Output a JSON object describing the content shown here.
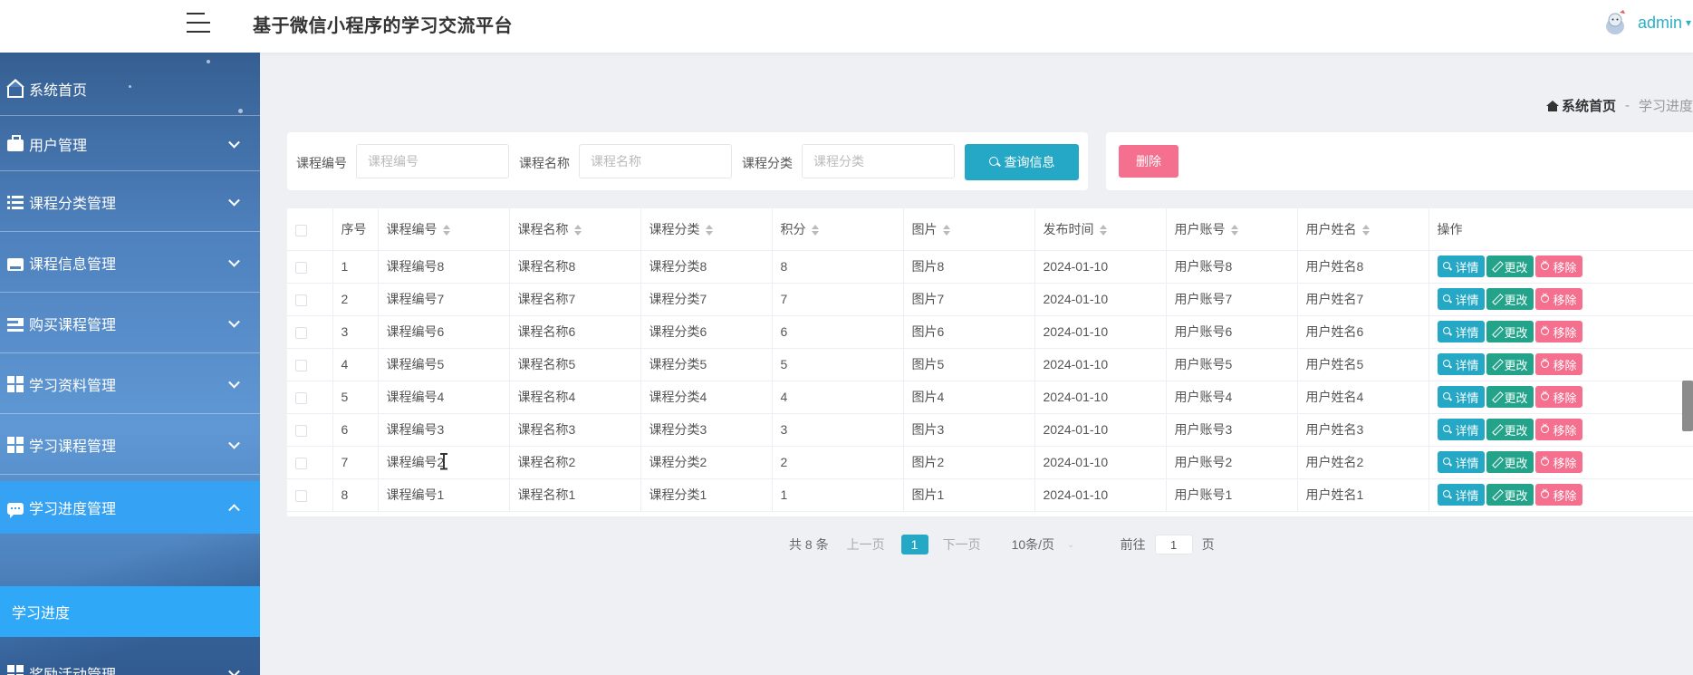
{
  "header": {
    "title": "基于微信小程序的学习交流平台",
    "username": "admin"
  },
  "sidebar": {
    "items": [
      {
        "label": "系统首页",
        "icon": "home-icon"
      },
      {
        "label": "用户管理",
        "icon": "briefcase-icon"
      },
      {
        "label": "课程分类管理",
        "icon": "list-icon"
      },
      {
        "label": "课程信息管理",
        "icon": "tray-icon"
      },
      {
        "label": "购买课程管理",
        "icon": "bars-icon"
      },
      {
        "label": "学习资料管理",
        "icon": "grid-icon"
      },
      {
        "label": "学习课程管理",
        "icon": "grid-icon"
      },
      {
        "label": "学习进度管理",
        "icon": "chat-icon"
      },
      {
        "label": "奖励活动管理",
        "icon": "grid-icon"
      }
    ],
    "active_sub": "学习进度"
  },
  "breadcrumb": {
    "home": "系统首页",
    "separator": "-",
    "current": "学习进度"
  },
  "search": {
    "label1": "课程编号",
    "placeholder1": "课程编号",
    "label2": "课程名称",
    "placeholder2": "课程名称",
    "label3": "课程分类",
    "placeholder3": "课程分类",
    "button": "查询信息"
  },
  "actions": {
    "delete": "删除"
  },
  "table": {
    "columns": [
      "序号",
      "课程编号",
      "课程名称",
      "课程分类",
      "积分",
      "图片",
      "发布时间",
      "用户账号",
      "用户姓名",
      "操作"
    ],
    "detail_label": "详情",
    "edit_label": "更改",
    "remove_label": "移除",
    "rows": [
      [
        "1",
        "课程编号8",
        "课程名称8",
        "课程分类8",
        "8",
        "图片8",
        "2024-01-10",
        "用户账号8",
        "用户姓名8"
      ],
      [
        "2",
        "课程编号7",
        "课程名称7",
        "课程分类7",
        "7",
        "图片7",
        "2024-01-10",
        "用户账号7",
        "用户姓名7"
      ],
      [
        "3",
        "课程编号6",
        "课程名称6",
        "课程分类6",
        "6",
        "图片6",
        "2024-01-10",
        "用户账号6",
        "用户姓名6"
      ],
      [
        "4",
        "课程编号5",
        "课程名称5",
        "课程分类5",
        "5",
        "图片5",
        "2024-01-10",
        "用户账号5",
        "用户姓名5"
      ],
      [
        "5",
        "课程编号4",
        "课程名称4",
        "课程分类4",
        "4",
        "图片4",
        "2024-01-10",
        "用户账号4",
        "用户姓名4"
      ],
      [
        "6",
        "课程编号3",
        "课程名称3",
        "课程分类3",
        "3",
        "图片3",
        "2024-01-10",
        "用户账号3",
        "用户姓名3"
      ],
      [
        "7",
        "课程编号2",
        "课程名称2",
        "课程分类2",
        "2",
        "图片2",
        "2024-01-10",
        "用户账号2",
        "用户姓名2"
      ],
      [
        "8",
        "课程编号1",
        "课程名称1",
        "课程分类1",
        "1",
        "图片1",
        "2024-01-10",
        "用户账号1",
        "用户姓名1"
      ]
    ]
  },
  "pagination": {
    "total": "共 8 条",
    "prev": "上一页",
    "page": "1",
    "next": "下一页",
    "page_size": "10条/页",
    "goto_prefix": "前往",
    "goto_value": "1",
    "goto_suffix": "页"
  },
  "colors": {
    "accent": "#25a8c6",
    "edit": "#23a48a",
    "danger": "#f56f8e",
    "sidebar_active": "#35a2f3"
  }
}
